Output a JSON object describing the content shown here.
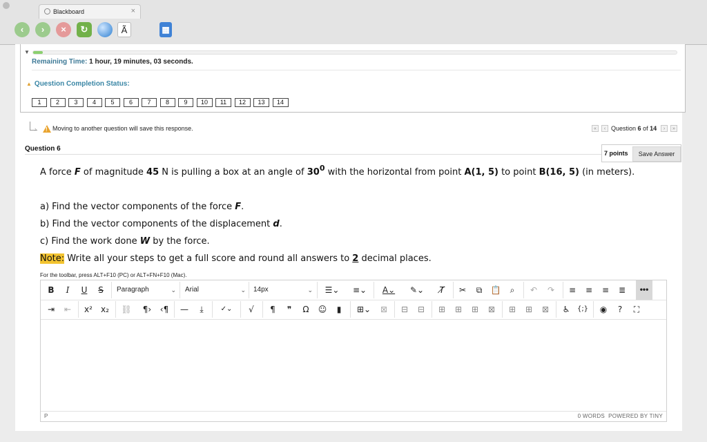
{
  "browser": {
    "tab_title": "Blackboard",
    "tab_close": "×"
  },
  "toolbar": {
    "back_icon": "back-arrow-icon",
    "forward_icon": "forward-arrow-icon",
    "stop_icon": "stop-icon",
    "reload_icon": "reload-icon",
    "home_icon": "globe-icon",
    "font_glyph": "Ã",
    "calculator_icon": "calculator-icon"
  },
  "progress": {
    "fraction_complete": 0.015
  },
  "timer": {
    "label": "Remaining Time:",
    "value": "1 hour, 19 minutes, 03 seconds."
  },
  "completion": {
    "label": "Question Completion Status:",
    "questions": [
      "1",
      "2",
      "3",
      "4",
      "5",
      "6",
      "7",
      "8",
      "9",
      "10",
      "11",
      "12",
      "13",
      "14"
    ]
  },
  "warning": {
    "text": "Moving to another question will save this response."
  },
  "navigation": {
    "prefix": "Question",
    "current": "6",
    "of": "of",
    "total": "14"
  },
  "question": {
    "heading": "Question 6",
    "points": "7 points",
    "save_label": "Save Answer"
  },
  "body": {
    "line1_a": "A force ",
    "force_var": "F",
    "line1_b": " of magnitude ",
    "magnitude": "45",
    "line1_c": " N is pulling a box at an angle of ",
    "angle": "30",
    "angle_sup": "0",
    "line1_d": " with the horizontal from point ",
    "point_a": "A(1, 5)",
    "line1_e": " to point ",
    "point_b": "B(16, 5)",
    "line1_f": " (in meters).",
    "part_a_text": "a) Find the vector components of the force ",
    "part_a_var": "F",
    "part_a_end": ".",
    "part_b_text": "b) Find the vector components of the displacement ",
    "part_b_var": "d",
    "part_b_end": ".",
    "part_c_text": "c) Find the work done ",
    "part_c_var": "W",
    "part_c_end": " by the force.",
    "note_label": "Note:",
    "note_text": " Write all your steps to get a full score and round all answers to ",
    "note_number": "2",
    "note_end": " decimal places."
  },
  "editor": {
    "hint": "For the toolbar, press ALT+F10 (PC) or ALT+FN+F10 (Mac).",
    "format_select": "Paragraph",
    "font_select": "Arial",
    "size_select": "14px",
    "status_path": "P",
    "word_count": "0 WORDS",
    "powered_by": "POWERED BY TINY",
    "buttons_row1": [
      "B",
      "I",
      "U",
      "S",
      "list-bullet",
      "list-number",
      "text-color",
      "highlight",
      "clear-format",
      "cut",
      "copy",
      "paste",
      "find",
      "undo",
      "redo",
      "align-left",
      "align-center",
      "align-right",
      "justify",
      "more"
    ],
    "buttons_row2": [
      "indent",
      "outdent",
      "superscript",
      "subscript",
      "unlink",
      "ltr",
      "rtl",
      "hr",
      "insert",
      "spellcheck",
      "math",
      "pilcrow",
      "quote",
      "omega",
      "emoji",
      "bookmark",
      "table",
      "table-delete",
      "row",
      "col",
      "cell",
      "merge",
      "split",
      "accessibility",
      "code",
      "preview",
      "help",
      "fullscreen"
    ]
  }
}
